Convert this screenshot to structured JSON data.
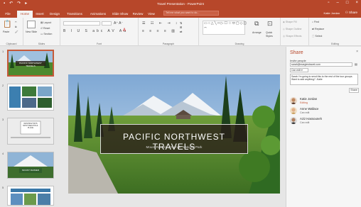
{
  "app": {
    "title": "Travel Presentation - PowerPoint",
    "user": "Katie Jordan",
    "share_label": "Share",
    "tell_me_placeholder": "Tell me what you want to do..."
  },
  "tabs": [
    "File",
    "Home",
    "Insert",
    "Design",
    "Transitions",
    "Animations",
    "Slide Show",
    "Review",
    "View"
  ],
  "ribbon": {
    "clipboard": {
      "paste": "Paste",
      "label": "Clipboard"
    },
    "slides": {
      "new_slide": "New Slide",
      "layout": "Layout",
      "reset": "Reset",
      "section": "Section",
      "label": "Slides"
    },
    "font": {
      "label": "Font"
    },
    "paragraph": {
      "label": "Paragraph"
    },
    "drawing": {
      "arrange": "Arrange",
      "quick_styles": "Quick Styles",
      "shape_fill": "Shape Fill",
      "shape_outline": "Shape Outline",
      "shape_effects": "Shape Effects",
      "label": "Drawing"
    },
    "editing": {
      "find": "Find",
      "replace": "Replace",
      "select": "Select",
      "label": "Editing"
    }
  },
  "thumbnails": [
    {
      "num": "1",
      "caption": "PACIFIC NORTHWEST TRAVELS"
    },
    {
      "num": "2",
      "caption": ""
    },
    {
      "num": "3",
      "caption": "WASHINGTON'S MOST BEAUTIFUL PLACE"
    },
    {
      "num": "4",
      "caption": "MOUNT RAINIER"
    },
    {
      "num": "5",
      "caption": ""
    }
  ],
  "slide": {
    "title": "PACIFIC NORTHWEST TRAVELS",
    "subtitle": "Mount Rainier, , Olympic National Park"
  },
  "share_pane": {
    "header": "Share",
    "invite_label": "Invite people",
    "email_value": "sarah@margiestravel.com",
    "permission": "Can edit",
    "message": "Sarah I'm going to send this to the rest of the tour groups. Want to add anything? -Katie",
    "share_button": "Share",
    "people": [
      {
        "name": "Katie Jordan",
        "status": "Editing"
      },
      {
        "name": "Anne Wallace",
        "status": "Can edit"
      },
      {
        "name": "Aziz Hassouneh",
        "status": "Can edit"
      }
    ]
  },
  "colors": {
    "accent": "#b7472a",
    "editing": "#c55a3a"
  }
}
